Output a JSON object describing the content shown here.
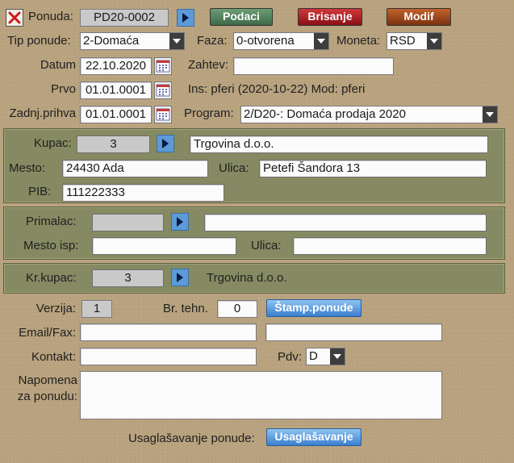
{
  "header": {
    "ponuda_label": "Ponuda:",
    "ponuda_value": "PD20-0002",
    "podaci_button": "Podaci",
    "brisanje_button": "Brisanje",
    "modif_button": "Modif"
  },
  "row_tip": {
    "tip_label": "Tip ponude:",
    "tip_value": "2-Domaća",
    "faza_label": "Faza:",
    "faza_value": "0-otvorena",
    "moneta_label": "Moneta:",
    "moneta_value": "RSD"
  },
  "row_datum": {
    "datum_label": "Datum",
    "datum_value": "22.10.2020",
    "zahtev_label": "Zahtev:",
    "zahtev_value": ""
  },
  "row_prvo": {
    "prvo_label": "Prvo",
    "prvo_value": "01.01.0001",
    "ins_text": "Ins: pferi (2020-10-22) Mod: pferi"
  },
  "row_zadnj": {
    "zadnj_label": "Zadnj.prihva",
    "zadnj_value": "01.01.0001",
    "program_label": "Program:",
    "program_value": "2/D20-: Domaća prodaja 2020"
  },
  "kupac_panel": {
    "kupac_label": "Kupac:",
    "kupac_value": "3",
    "kupac_name": "Trgovina d.o.o.",
    "mesto_label": "Mesto:",
    "mesto_value": "24430 Ada",
    "ulica_label": "Ulica:",
    "ulica_value": "Petefi Šandora 13",
    "pib_label": "PIB:",
    "pib_value": "111222333"
  },
  "primalac_panel": {
    "primalac_label": "Primalac:",
    "primalac_value": "",
    "primalac_name": "",
    "mesto_isp_label": "Mesto isp:",
    "mesto_isp_value": "",
    "ulica_label": "Ulica:",
    "ulica_value": ""
  },
  "krkupac_panel": {
    "krkupac_label": "Kr.kupac:",
    "krkupac_value": "3",
    "krkupac_name": "Trgovina d.o.o."
  },
  "footer": {
    "verzija_label": "Verzija:",
    "verzija_value": "1",
    "brtehn_label": "Br. tehn.",
    "brtehn_value": "0",
    "stamp_button": "Štamp.ponude",
    "email_label": "Email/Fax:",
    "email_value": "",
    "email2_value": "",
    "kontakt_label": "Kontakt:",
    "kontakt_value": "",
    "pdv_label": "Pdv:",
    "pdv_value": "D",
    "napomena_label_1": "Napomena",
    "napomena_label_2": "za ponudu:",
    "napomena_value": "",
    "usaglasavanje_label": "Usaglašavanje ponude:",
    "usaglasavanje_button": "Usaglašavanje"
  }
}
